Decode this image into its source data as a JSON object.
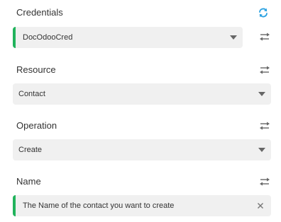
{
  "credentials": {
    "label": "Credentials",
    "selected": "DocOdooCred",
    "icons": {
      "refresh": "refresh-icon",
      "swap": "swap-icon"
    },
    "colors": {
      "refresh": "#2aa1e1",
      "accent": "#21b35c"
    }
  },
  "resource": {
    "label": "Resource",
    "selected": "Contact",
    "icons": {
      "swap": "swap-icon"
    }
  },
  "operation": {
    "label": "Operation",
    "selected": "Create",
    "icons": {
      "swap": "swap-icon"
    }
  },
  "name": {
    "label": "Name",
    "value": "The Name of the contact you want to create",
    "icons": {
      "swap": "swap-icon",
      "clear": "close-icon"
    },
    "colors": {
      "accent": "#21b35c"
    }
  }
}
